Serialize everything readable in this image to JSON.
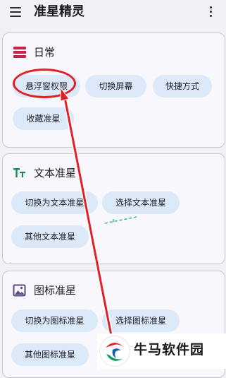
{
  "app": {
    "title": "准星精灵"
  },
  "sections": [
    {
      "title": "日常",
      "icon": "calendar-icon",
      "buttons": [
        "悬浮窗权限",
        "切换屏幕",
        "快捷方式",
        "收藏准星"
      ]
    },
    {
      "title": "文本准星",
      "icon": "text-format-icon",
      "buttons": [
        "切换为文本准星",
        "选择文本准星",
        "其他文本准星"
      ]
    },
    {
      "title": "图标准星",
      "icon": "image-icon",
      "buttons": [
        "切换为图标准星",
        "选择图标准星",
        "其他图标准星"
      ]
    }
  ],
  "watermark": {
    "text": "牛马软件园"
  },
  "colors": {
    "accent_red": "#e21f26",
    "chip": "#dce9f8",
    "icon_red": "#c8244a",
    "icon_green": "#1a8a5a",
    "icon_purple": "#5b4a86"
  }
}
